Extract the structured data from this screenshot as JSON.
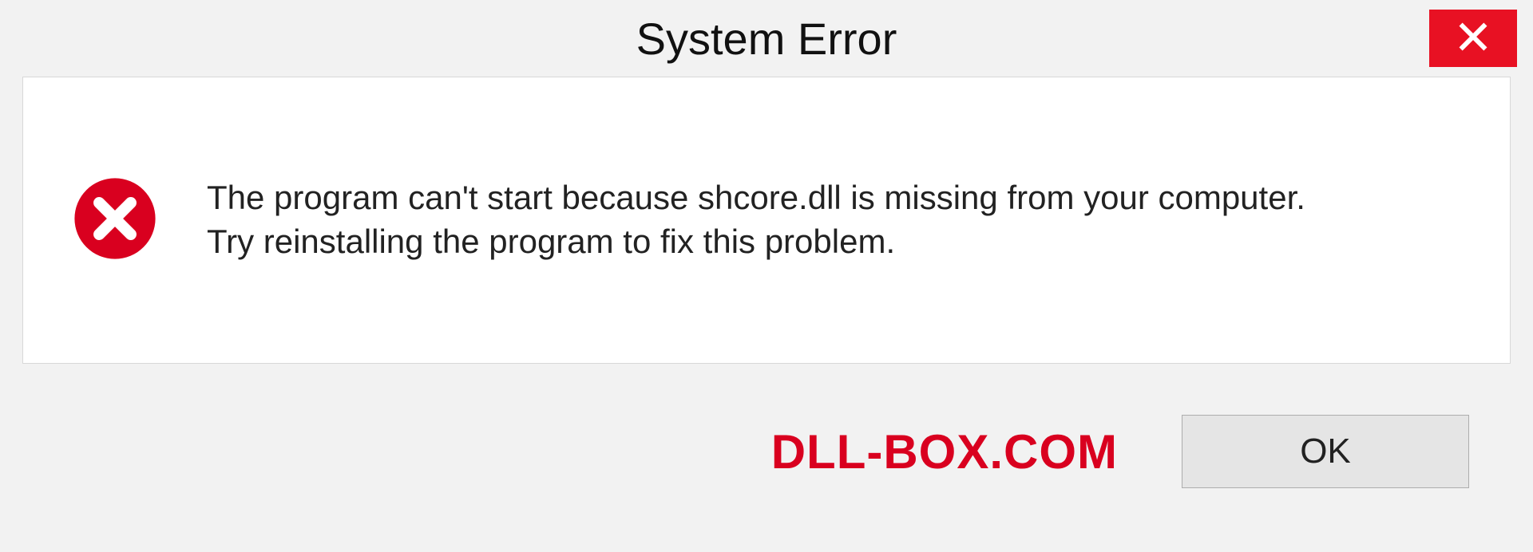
{
  "titlebar": {
    "title": "System Error"
  },
  "message": {
    "line1": "The program can't start because shcore.dll is missing from your computer.",
    "line2": "Try reinstalling the program to fix this problem."
  },
  "footer": {
    "watermark": "DLL-BOX.COM",
    "ok_label": "OK"
  },
  "colors": {
    "close_bg": "#e81123",
    "error_red": "#d9001f",
    "window_bg": "#f2f2f2",
    "content_bg": "#ffffff"
  }
}
